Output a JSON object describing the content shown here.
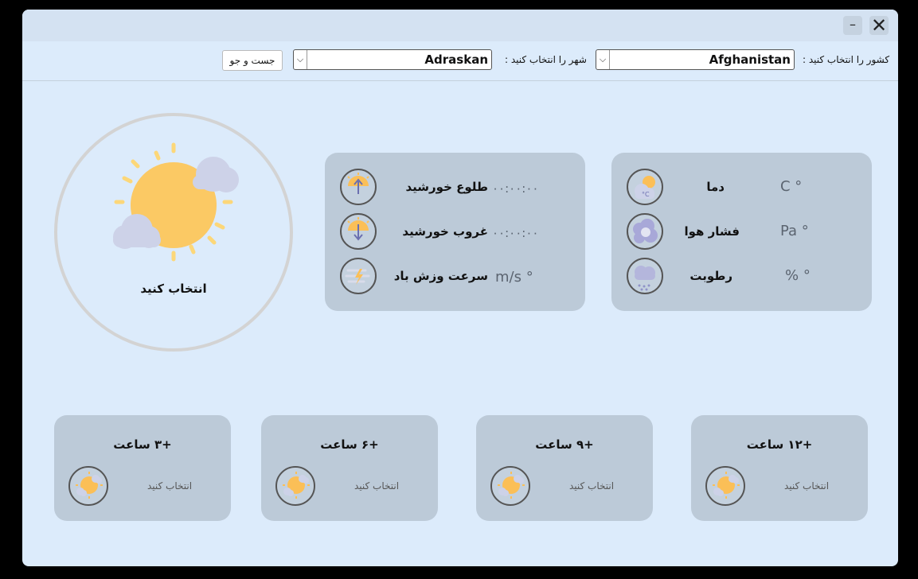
{
  "window": {
    "minimize_label": "–",
    "close_label": "✕"
  },
  "toolbar": {
    "country_label": "کشور را انتخاب کنید :",
    "country_value": "Afghanistan",
    "city_label": "شهر را انتخاب کنید :",
    "city_value": "Adraskan",
    "search_label": "جست و جو",
    "chevron": "⌵"
  },
  "main": {
    "current_label": "انتخاب کنید",
    "icon": "sun-behind-clouds-icon"
  },
  "stats_right": [
    {
      "name": "دما",
      "value": "C °",
      "icon": "thermometer-cloud-icon"
    },
    {
      "name": "فشار هوا",
      "value": "Pa °",
      "icon": "pressure-cloud-icon"
    },
    {
      "name": "رطوبت",
      "value": "% °",
      "icon": "humidity-cloud-icon"
    }
  ],
  "stats_left": [
    {
      "name": "طلوع خورشید",
      "value": "۰۰:۰۰:۰۰",
      "icon": "sunrise-icon"
    },
    {
      "name": "غروب خورشید",
      "value": "۰۰:۰۰:۰۰",
      "icon": "sunset-icon"
    },
    {
      "name": "سرعت وزش باد",
      "value": "m/s °",
      "icon": "wind-icon"
    }
  ],
  "forecast": [
    {
      "title": "+۱۲ ساعت",
      "label": "انتخاب کنید"
    },
    {
      "title": "+۹ ساعت",
      "label": "انتخاب کنید"
    },
    {
      "title": "+۶ ساعت",
      "label": "انتخاب کنید"
    },
    {
      "title": "+۳ ساعت",
      "label": "انتخاب کنید"
    }
  ],
  "colors": {
    "background": "#dcebfb",
    "panel": "#bccad8",
    "sun": "#fbbf57",
    "cloud": "#c9cde6"
  }
}
